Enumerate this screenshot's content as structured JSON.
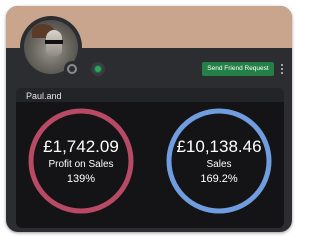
{
  "profile": {
    "username": "Paul.and",
    "friend_button_label": "Send Friend Request"
  },
  "stats": {
    "profit": {
      "value": "£1,742.09",
      "label": "Profit on Sales",
      "percent": "139%",
      "color": "#b84a66"
    },
    "sales": {
      "value": "£10,138.46",
      "label": "Sales",
      "percent": "169.2%",
      "color": "#6f9de0"
    }
  },
  "colors": {
    "banner": "#c9a58e",
    "card": "#2c2d31",
    "panel": "#141416",
    "button": "#248046"
  }
}
